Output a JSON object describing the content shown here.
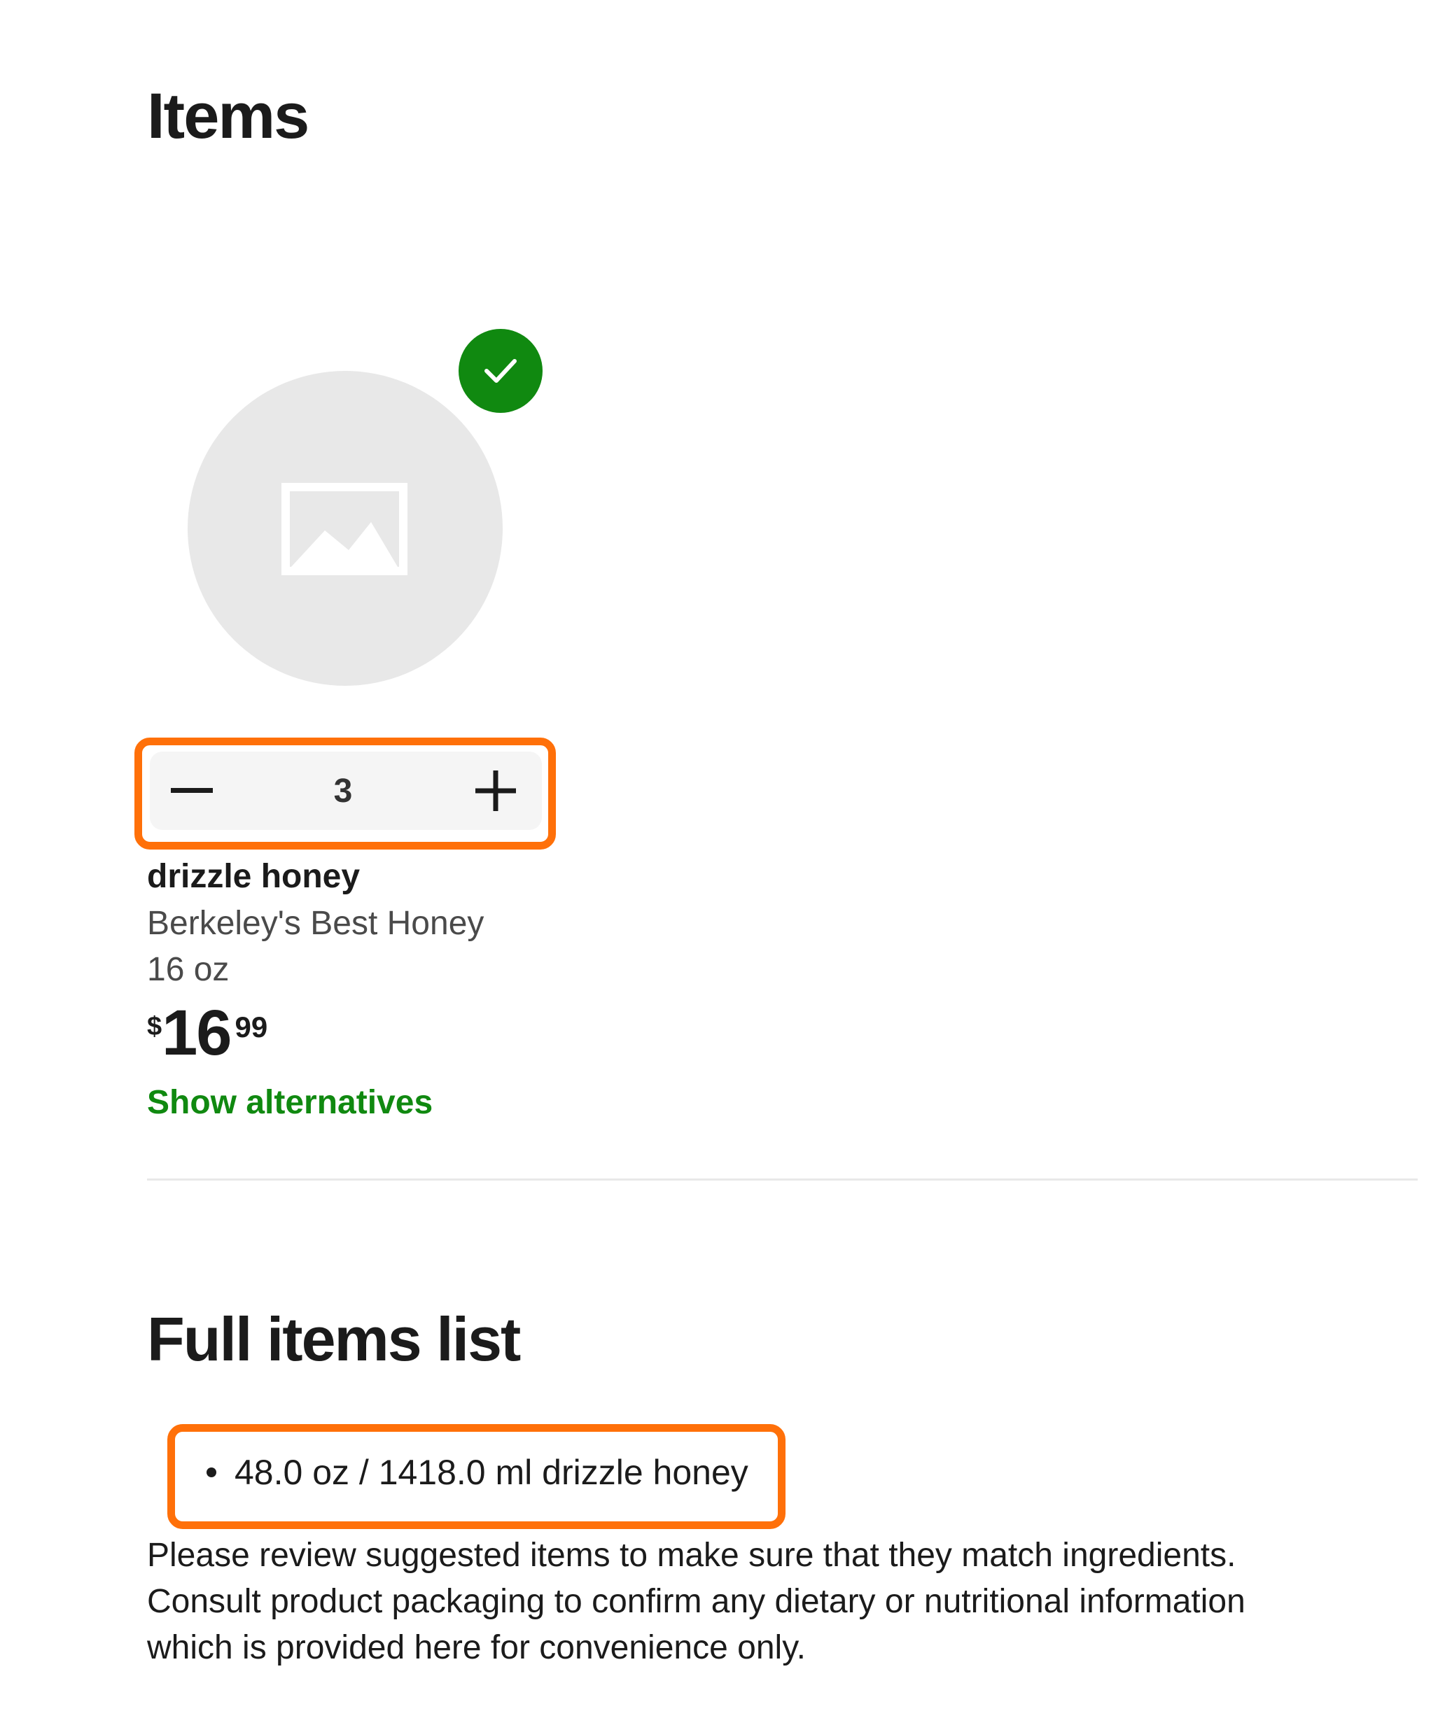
{
  "items_section": {
    "title": "Items"
  },
  "product": {
    "image_icon": "image-placeholder-icon",
    "selected_badge_icon": "checkmark-icon",
    "quantity": "3",
    "decrement_icon": "minus-icon",
    "increment_icon": "plus-icon",
    "name": "drizzle honey",
    "brand": "Berkeley's Best Honey",
    "size": "16 oz",
    "price": {
      "currency": "$",
      "dollars": "16",
      "cents": "99"
    },
    "alternatives_link": "Show alternatives"
  },
  "full_list": {
    "title": "Full items list",
    "items": [
      "48.0 oz / 1418.0 ml drizzle honey"
    ],
    "disclaimer": [
      "Please review suggested items to make sure that they match ingredients.",
      "Consult product packaging to confirm any dietary or nutritional information",
      "which is provided here for convenience only."
    ]
  },
  "colors": {
    "accent_green": "#108910",
    "highlight_orange": "#ff7009",
    "placeholder_gray": "#e8e8e8",
    "stepper_bg": "#f5f5f5"
  }
}
